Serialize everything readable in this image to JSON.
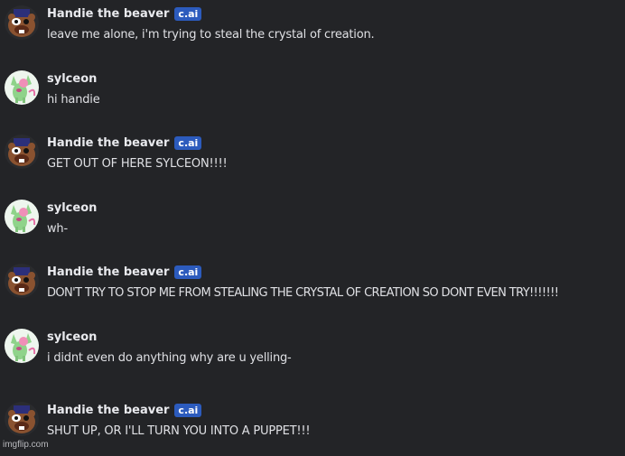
{
  "messages": [
    {
      "username": "Handie the beaver",
      "badge": "c.ai",
      "avatar": "beaver-avatar",
      "text": "leave me alone, i'm trying to steal the crystal of creation."
    },
    {
      "username": "sylceon",
      "avatar": "sylceon-avatar",
      "text": "hi handie"
    },
    {
      "username": "Handie the beaver",
      "badge": "c.ai",
      "avatar": "beaver-avatar",
      "text": "GET OUT OF HERE SYLCEON!!!!"
    },
    {
      "username": "sylceon",
      "avatar": "sylceon-avatar",
      "text": "wh-"
    },
    {
      "username": "Handie the beaver",
      "badge": "c.ai",
      "avatar": "beaver-avatar",
      "text": "DON'T TRY TO STOP ME FROM STEALING THE CRYSTAL OF CREATION SO DONT EVEN TRY!!!!!!!"
    },
    {
      "username": "sylceon",
      "avatar": "sylceon-avatar",
      "text": "i didnt even do anything why are u yelling-"
    },
    {
      "username": "Handie the beaver",
      "badge": "c.ai",
      "avatar": "beaver-avatar",
      "text": "SHUT UP, OR I'LL TURN YOU INTO A PUPPET!!!"
    }
  ],
  "watermark": "imgflip.com",
  "colors": {
    "background": "#232427",
    "badge": "#2c5bbd",
    "username": "#e9eaee",
    "text": "#dfe0e4"
  }
}
